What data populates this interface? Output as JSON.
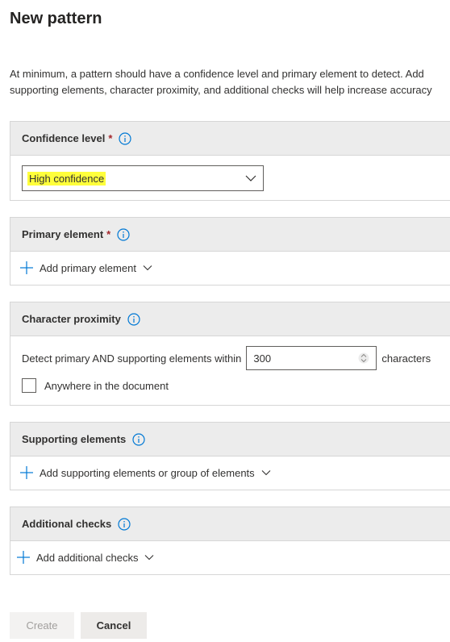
{
  "page": {
    "title": "New pattern",
    "intro_line1": "At minimum, a pattern should have a confidence level and primary element to detect. Add",
    "intro_line2": "supporting elements, character proximity, and additional checks will help increase accuracy"
  },
  "confidence": {
    "label": "Confidence level",
    "required_mark": "*",
    "selected": "High confidence"
  },
  "primary": {
    "label": "Primary element",
    "required_mark": "*",
    "add_label": "Add primary element"
  },
  "proximity": {
    "label": "Character proximity",
    "detect_label": "Detect primary AND supporting elements within",
    "value": "300",
    "suffix": "characters",
    "anywhere_label": "Anywhere in the document",
    "anywhere_checked": false
  },
  "supporting": {
    "label": "Supporting elements",
    "add_label": "Add supporting elements or group of elements"
  },
  "additional": {
    "label": "Additional checks",
    "add_label": "Add additional checks"
  },
  "buttons": {
    "create": "Create",
    "cancel": "Cancel"
  },
  "colors": {
    "accent": "#0078d4",
    "highlight": "#ffff3b",
    "header_bg": "#ececec",
    "required": "#a4262c"
  },
  "icons": {
    "info": "info-icon",
    "chevron": "chevron-down-icon",
    "add": "plus-icon",
    "spinner": "spin-arrows-icon"
  }
}
